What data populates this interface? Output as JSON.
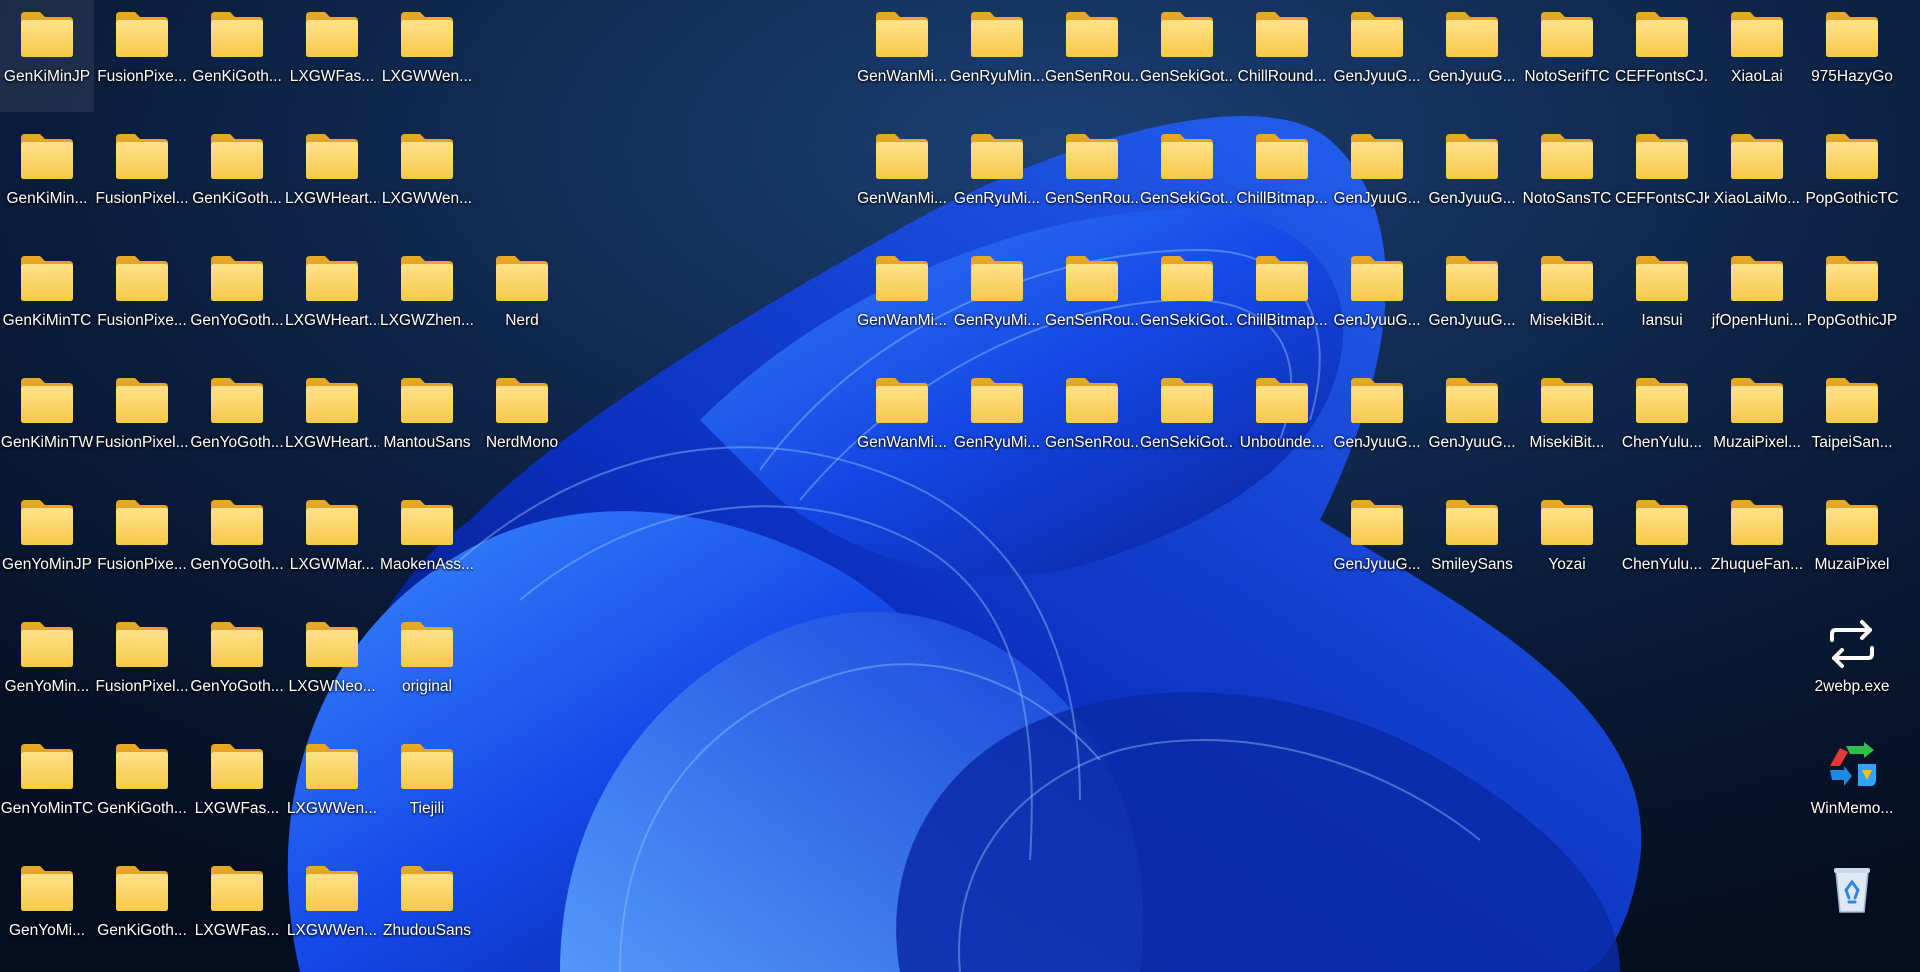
{
  "desktop": {
    "left_columns": [
      [
        "GenKiMinJP",
        "GenKiMin...",
        "GenKiMinTC",
        "GenKiMinTW",
        "GenYoMinJP",
        "GenYoMin...",
        "GenYoMinTC",
        "GenYoMi..."
      ],
      [
        "FusionPixe...",
        "FusionPixel...",
        "FusionPixe...",
        "FusionPixel...",
        "FusionPixe...",
        "FusionPixel...",
        "GenKiGoth...",
        "GenKiGoth..."
      ],
      [
        "GenKiGoth...",
        "GenKiGoth...",
        "GenYoGoth...",
        "GenYoGoth...",
        "GenYoGoth...",
        "GenYoGoth...",
        "LXGWFas...",
        "LXGWFas..."
      ],
      [
        "LXGWFas...",
        "LXGWHeart...",
        "LXGWHeart...",
        "LXGWHeart...",
        "LXGWMar...",
        "LXGWNeo...",
        "LXGWWen...",
        "LXGWWen..."
      ],
      [
        "LXGWWen...",
        "LXGWWen...",
        "LXGWZhen...",
        "MantouSans",
        "MaokenAss...",
        "original",
        "Tiejili",
        "ZhudouSans"
      ],
      [
        "",
        "",
        "Nerd",
        "NerdMono",
        "",
        "",
        "",
        ""
      ]
    ],
    "right_columns": [
      [
        "GenWanMi...",
        "GenWanMi...",
        "GenWanMi...",
        "GenWanMi...",
        "",
        "",
        "",
        ""
      ],
      [
        "GenRyuMin...",
        "GenRyuMi...",
        "GenRyuMi...",
        "GenRyuMi...",
        "",
        "",
        "",
        ""
      ],
      [
        "GenSenRou...",
        "GenSenRou...",
        "GenSenRou...",
        "GenSenRou...",
        "",
        "",
        "",
        ""
      ],
      [
        "GenSekiGot...",
        "GenSekiGot...",
        "GenSekiGot...",
        "GenSekiGot...",
        "",
        "",
        "",
        ""
      ],
      [
        "ChillRound...",
        "ChillBitmap...",
        "ChillBitmap...",
        "Unbounde...",
        "",
        "",
        "",
        ""
      ],
      [
        "GenJyuuG...",
        "GenJyuuG...",
        "GenJyuuG...",
        "GenJyuuG...",
        "GenJyuuG...",
        "",
        "",
        ""
      ],
      [
        "GenJyuuG...",
        "GenJyuuG...",
        "GenJyuuG...",
        "GenJyuuG...",
        "SmileySans",
        "",
        "",
        ""
      ],
      [
        "NotoSerifTC",
        "NotoSansTC",
        "MisekiBit...",
        "MisekiBit...",
        "Yozai",
        "",
        "",
        ""
      ],
      [
        "CEFFontsCJ...",
        "CEFFontsCJK",
        "Iansui",
        "ChenYulu...",
        "ChenYulu...",
        "",
        "",
        ""
      ],
      [
        "XiaoLai",
        "XiaoLaiMo...",
        "jfOpenHuni...",
        "MuzaiPixel...",
        "ZhuqueFan...",
        "",
        "",
        ""
      ],
      [
        "975HazyGo",
        "PopGothicTC",
        "PopGothicJP",
        "TaipeiSan...",
        "MuzaiPixel",
        "2webp.exe",
        "WinMemo...",
        ""
      ]
    ],
    "special_icons": {
      "2webp.exe": "convert-arrows-icon",
      "WinMemo...": "memory-cleaner-icon",
      "recycle_bin": "recycle-bin-icon"
    }
  }
}
